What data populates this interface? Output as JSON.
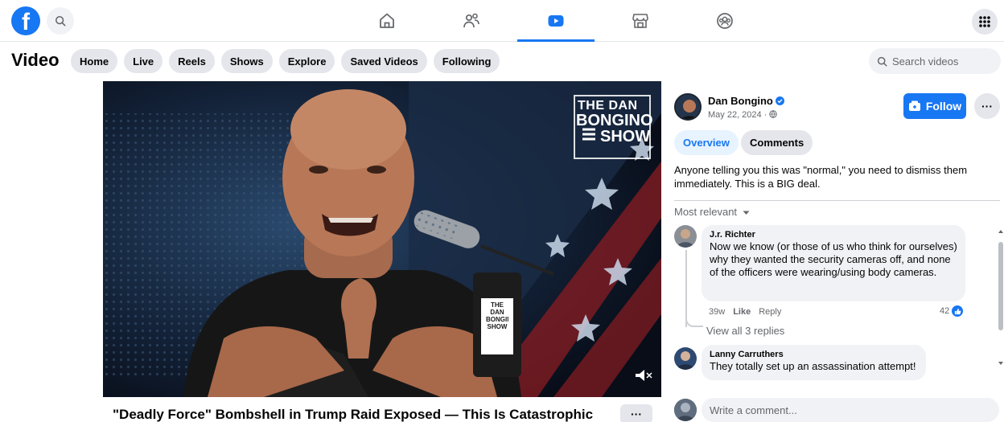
{
  "topbar": {
    "logo": "f",
    "nav": [
      {
        "name": "home",
        "icon": "home-icon"
      },
      {
        "name": "friends",
        "icon": "friends-icon"
      },
      {
        "name": "video",
        "icon": "video-icon",
        "active": true
      },
      {
        "name": "marketplace",
        "icon": "marketplace-icon"
      },
      {
        "name": "groups",
        "icon": "groups-icon"
      }
    ]
  },
  "subnav": {
    "title": "Video",
    "pills": [
      "Home",
      "Live",
      "Reels",
      "Shows",
      "Explore",
      "Saved Videos",
      "Following"
    ],
    "search_placeholder": "Search videos"
  },
  "video": {
    "logo_line1": "THE DAN",
    "logo_line2": "BONGINO",
    "logo_line3": "SHOW",
    "mic_label": "THE DAN BONGINO SHOW",
    "title": "\"Deadly Force\" Bombshell in Trump Raid Exposed — This Is Catastrophic",
    "more": "···"
  },
  "panel": {
    "author": "Dan Bongino",
    "date": "May 22, 2024 · ",
    "follow_label": "Follow",
    "dots": "···",
    "tabs": [
      "Overview",
      "Comments"
    ],
    "description": "Anyone telling you this was \"normal,\" you need to dismiss them immediately. This is a BIG deal.",
    "sort_label": "Most relevant",
    "comments": [
      {
        "name": "J.r. Richter",
        "text": "Now we know (or those of us who think for ourselves) why they wanted the security cameras off, and none of the officers were wearing/using body cameras.",
        "time": "39w",
        "like": "Like",
        "reply": "Reply",
        "reactions": "42",
        "view_replies": "View all 3 replies"
      },
      {
        "name": "Lanny Carruthers",
        "text": "They totally set up an assassination attempt!"
      }
    ],
    "write_placeholder": "Write a comment..."
  },
  "colors": {
    "brand": "#1877f2",
    "pill_bg": "#e4e6eb",
    "muted_text": "#65676b"
  }
}
